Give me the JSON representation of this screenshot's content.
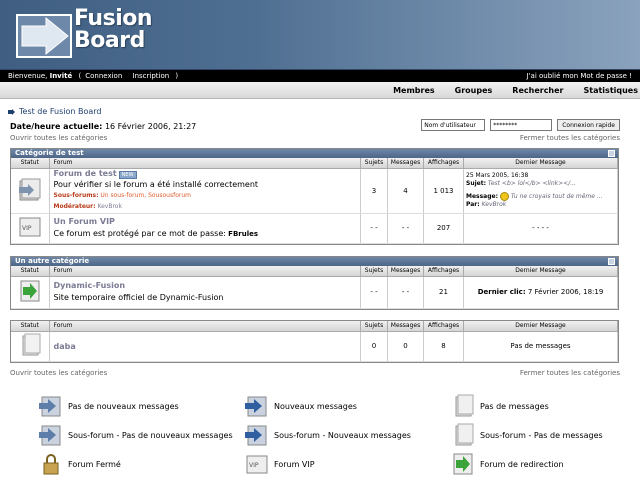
{
  "brand": {
    "line1": "Fusion",
    "line2": "Board"
  },
  "userbar": {
    "welcome": "Bienvenue,",
    "user": "Invité",
    "open": "(",
    "login": "Connexion",
    "register": "Inscription",
    "close": ")",
    "forgot": "J'ai oublié mon Mot de passe !"
  },
  "nav": [
    "Membres",
    "Groupes",
    "Rechercher",
    "Statistiques"
  ],
  "breadcrumb": "Test de Fusion Board",
  "datetime": {
    "label": "Date/heure actuelle:",
    "value": "16 Février 2006, 21:27"
  },
  "login": {
    "username_value": "Nom d'utilisateur",
    "password_value": "********",
    "submit": "Connexion rapide"
  },
  "toggles": {
    "open_all": "Ouvrir toutes les catégories",
    "close_all": "Fermer toutes les catégories"
  },
  "columns": {
    "status": "Statut",
    "forum": "Forum",
    "subjects": "Sujets",
    "messages": "Messages",
    "views": "Affichages",
    "last": "Dernier Message"
  },
  "categories": [
    {
      "title": "Catégorie de test",
      "forums": [
        {
          "name": "Forum de test",
          "new_badge": "NEW",
          "desc": "Pour vérifier si le forum a été installé correctement",
          "sub_label": "Sous-forums:",
          "subforums": "Un sous-forum, Sousousforum",
          "mod_label": "Modérateur:",
          "moderator": "KevBrok",
          "subjects": "3",
          "messages": "4",
          "views": "1 013",
          "last": {
            "date": "25 Mars 2005, 16:38",
            "subject_label": "Sujet:",
            "subject": "Test <b> lol</b> <link></...",
            "message_label": "Message:",
            "message": "Tu ne croyais tout de même ...",
            "by_label": "Par:",
            "by": "KevBrok"
          }
        },
        {
          "name": "Un Forum VIP",
          "desc": "Ce forum est protégé par ce mot de passe:",
          "password": "FBrules",
          "subjects": "- -",
          "messages": "- -",
          "views": "207",
          "last_text": "- - - -"
        }
      ]
    },
    {
      "title": "Un autre catégorie",
      "forums": [
        {
          "name": "Dynamic-Fusion",
          "desc": "Site temporaire officiel de Dynamic-Fusion",
          "subjects": "- -",
          "messages": "- -",
          "views": "21",
          "last_label": "Dernier clic:",
          "last_text": "7 Février 2006, 18:19"
        }
      ]
    },
    {
      "title": "",
      "forums": [
        {
          "name": "daba",
          "desc": "",
          "subjects": "0",
          "messages": "0",
          "views": "8",
          "last_text": "Pas de messages"
        }
      ]
    }
  ],
  "legend": [
    {
      "icon": "folder-arrow-blue-icon",
      "label": "Pas de nouveaux messages"
    },
    {
      "icon": "folder-arrow-blue-icon",
      "label": "Nouveaux messages"
    },
    {
      "icon": "document-gray-icon",
      "label": "Pas de messages"
    },
    {
      "icon": "folder-arrow-blue-icon",
      "label": "Sous-forum - Pas de nouveaux messages"
    },
    {
      "icon": "folder-arrow-blue-icon",
      "label": "Sous-forum - Nouveaux messages"
    },
    {
      "icon": "document-gray-icon",
      "label": "Sous-forum - Pas de messages"
    },
    {
      "icon": "lock-icon",
      "label": "Forum Fermé"
    },
    {
      "icon": "vip-icon",
      "label": "Forum VIP"
    },
    {
      "icon": "redirect-icon",
      "label": "Forum de redirection"
    }
  ],
  "colors": {
    "header": "#4f6f92",
    "cathead": "#5c7596",
    "accent_link": "#e05c2d"
  }
}
